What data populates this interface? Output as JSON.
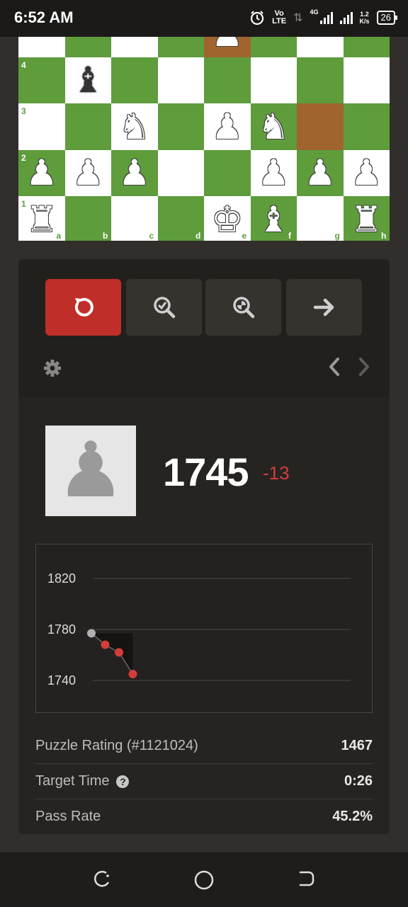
{
  "status_bar": {
    "time": "6:52 AM",
    "alarm_icon": "alarm-clock-icon",
    "volte_top": "Vo",
    "volte_bottom": "LTE",
    "network": "4G",
    "speed_value": "1.2",
    "speed_unit": "K/s",
    "battery": "26"
  },
  "board": {
    "rank_labels": [
      "4",
      "3",
      "2",
      "1"
    ],
    "file_labels": [
      "a",
      "b",
      "c",
      "d",
      "e",
      "f",
      "g",
      "h"
    ],
    "colors": {
      "light": "#ffffff",
      "dark": "#5e9c3c",
      "highlight": "#a2642f"
    },
    "highlighted_squares": [
      "e5",
      "g3"
    ],
    "pieces": [
      {
        "square": "e5",
        "color": "white",
        "type": "pawn",
        "glyph": "♟"
      },
      {
        "square": "b4",
        "color": "black",
        "type": "bishop",
        "glyph": "♝"
      },
      {
        "square": "c3",
        "color": "white",
        "type": "knight",
        "glyph": "♞"
      },
      {
        "square": "e3",
        "color": "white",
        "type": "pawn",
        "glyph": "♟"
      },
      {
        "square": "f3",
        "color": "white",
        "type": "knight",
        "glyph": "♞"
      },
      {
        "square": "a2",
        "color": "white",
        "type": "pawn",
        "glyph": "♟"
      },
      {
        "square": "b2",
        "color": "white",
        "type": "pawn",
        "glyph": "♟"
      },
      {
        "square": "c2",
        "color": "white",
        "type": "pawn",
        "glyph": "♟"
      },
      {
        "square": "f2",
        "color": "white",
        "type": "pawn",
        "glyph": "♟"
      },
      {
        "square": "g2",
        "color": "white",
        "type": "pawn",
        "glyph": "♟"
      },
      {
        "square": "h2",
        "color": "white",
        "type": "pawn",
        "glyph": "♟"
      },
      {
        "square": "a1",
        "color": "white",
        "type": "rook",
        "glyph": "♜"
      },
      {
        "square": "e1",
        "color": "white",
        "type": "king",
        "glyph": "♚"
      },
      {
        "square": "f1",
        "color": "white",
        "type": "bishop",
        "glyph": "♝"
      },
      {
        "square": "h1",
        "color": "white",
        "type": "rook",
        "glyph": "♜"
      }
    ]
  },
  "controls": {
    "buttons": [
      {
        "name": "retry-button",
        "icon": "retry-icon",
        "color": "#c02e2a"
      },
      {
        "name": "hint-button",
        "icon": "magnifier-check-icon"
      },
      {
        "name": "analysis-button",
        "icon": "magnifier-target-icon"
      },
      {
        "name": "next-button",
        "icon": "arrow-right-icon"
      }
    ],
    "settings_icon": "gear-icon",
    "prev_icon": "chevron-left-icon",
    "next_icon": "chevron-right-icon"
  },
  "player": {
    "avatar_icon": "pawn-avatar-icon",
    "rating": "1745",
    "delta": "-13",
    "delta_color": "#d23d3a"
  },
  "chart_data": {
    "type": "line",
    "y_ticks": [
      "1820",
      "1780",
      "1740"
    ],
    "ylim": [
      1730,
      1840
    ],
    "grid": true,
    "series": [
      {
        "values": [
          1777,
          1768,
          1762,
          1745
        ]
      }
    ],
    "point_colors": [
      "#b0b0b0",
      "#d23d3a",
      "#d23d3a",
      "#d23d3a"
    ]
  },
  "stats": [
    {
      "label": "Puzzle Rating (#1121024)",
      "value": "1467"
    },
    {
      "label": "Target Time",
      "value": "0:26",
      "help_icon": "question-icon"
    },
    {
      "label": "Pass Rate",
      "value": "45.2%"
    }
  ],
  "system_nav": {
    "recents_icon": "recents-icon",
    "home_icon": "home-circle-icon",
    "back_icon": "back-icon"
  }
}
